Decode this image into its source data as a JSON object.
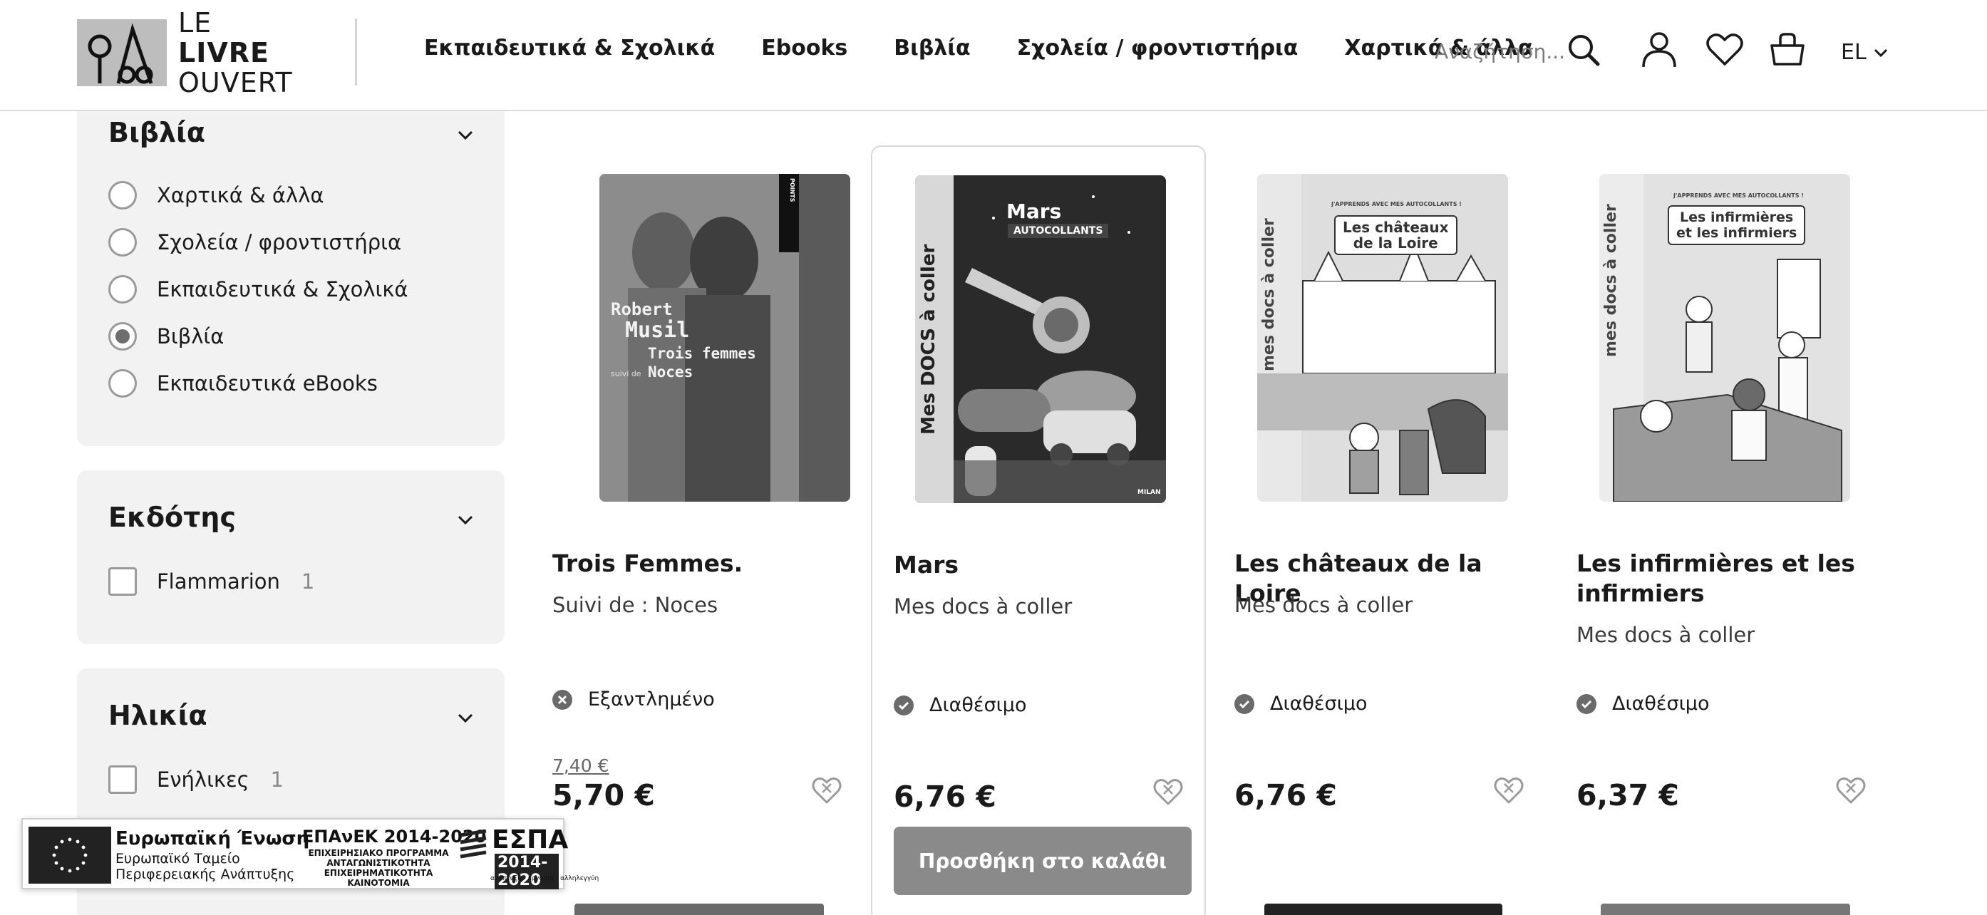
{
  "header": {
    "logo": {
      "line1_light": "LE ",
      "line1_bold": "LIVRE",
      "line2": "OUVERT"
    },
    "nav": [
      "Εκπαιδευτικά & Σχολικά",
      "Ebooks",
      "Βιβλία",
      "Σχολεία / φροντιστήρια",
      "Χαρτικά & άλλα"
    ],
    "search_placeholder": "Αναζήτηση...",
    "language": "EL",
    "icons": [
      "search-icon",
      "user-icon",
      "heart-icon",
      "basket-icon",
      "chevron-down-icon"
    ]
  },
  "sidebar": {
    "category": {
      "title": "Βιβλία",
      "options": [
        {
          "label": "Χαρτικά & άλλα",
          "checked": false
        },
        {
          "label": "Σχολεία / φροντιστήρια",
          "checked": false
        },
        {
          "label": "Εκπαιδευτικά & Σχολικά",
          "checked": false
        },
        {
          "label": "Βιβλία",
          "checked": true
        },
        {
          "label": "Εκπαιδευτικά eBooks",
          "checked": false
        }
      ]
    },
    "publisher": {
      "title": "Εκδότης",
      "options": [
        {
          "label": "Flammarion",
          "count": "1"
        }
      ]
    },
    "age": {
      "title": "Ηλικία",
      "options": [
        {
          "label": "Ενήλικες",
          "count": "1"
        }
      ]
    }
  },
  "products": [
    {
      "title": "Trois Femmes.",
      "subtitle": "Suivi de : Noces",
      "stock": "Εξαντλημένο",
      "stock_state": "out",
      "old_price": "7,40 €",
      "price": "5,70 €",
      "cover": {
        "author1": "Robert",
        "author2": "Musil",
        "title1": "Trois femmes",
        "suivi": "suivi de",
        "title2": "Noces",
        "spine": "POINTS"
      }
    },
    {
      "title": "Mars",
      "subtitle": "Mes docs à coller",
      "stock": "Διαθέσιμο",
      "stock_state": "in",
      "price": "6,76 €",
      "button": "Προσθήκη στο καλάθι",
      "cover": {
        "title": "Mars",
        "badge": "AUTOCOLLANTS",
        "series": "Mes DOCS à coller",
        "publisher": "MILAN"
      }
    },
    {
      "title": "Les châteaux de la Loire",
      "subtitle": "Mes docs à coller",
      "stock": "Διαθέσιμο",
      "stock_state": "in",
      "price": "6,76 €",
      "cover": {
        "title1": "Les châteaux",
        "title2": "de la Loire",
        "series": "mes docs à coller",
        "banner": "J'APPRENDS AVEC MES AUTOCOLLANTS !"
      }
    },
    {
      "title": "Les infirmières et les infirmiers",
      "subtitle": "Mes docs à coller",
      "stock": "Διαθέσιμο",
      "stock_state": "in",
      "price": "6,37 €",
      "cover": {
        "title1": "Les infirmières",
        "title2": "et les infirmiers",
        "series": "mes docs à coller",
        "banner": "J'APPRENDS AVEC MES AUTOCOLLANTS !"
      }
    }
  ],
  "eu_banner": {
    "title": "Ευρωπαϊκή Ένωση",
    "line1": "Ευρωπαϊκό Ταμείο",
    "line2": "Περιφερειακής Ανάπτυξης",
    "epanek": "ΕΠΑνΕΚ 2014-2020",
    "epanek_sub1": "ΕΠΙΧΕΙΡΗΣΙΑΚΟ ΠΡΟΓΡΑΜΜΑ",
    "epanek_sub2": "ΑΝΤΑΓΩΝΙΣΤΙΚΟΤΗΤΑ",
    "epanek_sub3": "ΕΠΙΧΕΙΡΗΜΑΤΙΚΟΤΗΤΑ",
    "epanek_sub4": "ΚΑΙΝΟΤΟΜΙΑ",
    "espa": "ΕΣΠΑ",
    "espa_years": "2014-2020",
    "espa_tag": "ανάπτυξη - εργασία - αλληλεγγύη"
  }
}
